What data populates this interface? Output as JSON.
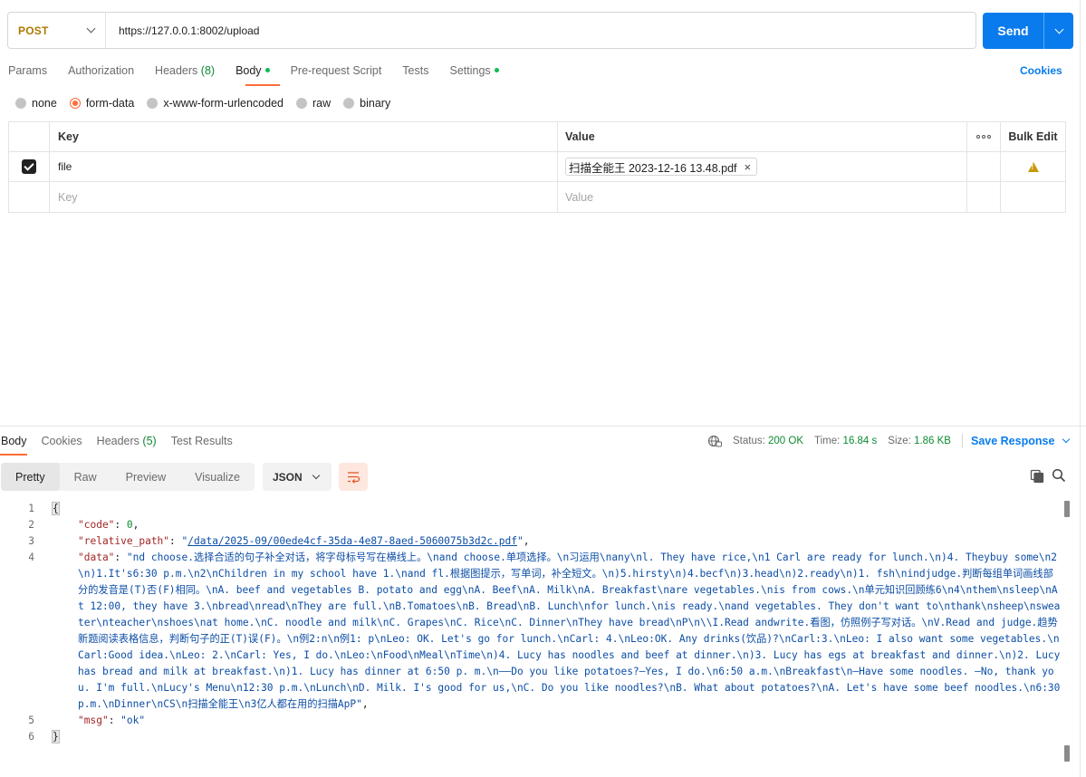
{
  "request": {
    "method": "POST",
    "url": "https://127.0.0.1:8002/upload",
    "send_label": "Send"
  },
  "tabs": {
    "params": "Params",
    "authorization": "Authorization",
    "headers": "Headers",
    "headers_count": "(8)",
    "body": "Body",
    "prerequest": "Pre-request Script",
    "tests": "Tests",
    "settings": "Settings",
    "cookies": "Cookies"
  },
  "body_types": [
    "none",
    "form-data",
    "x-www-form-urlencoded",
    "raw",
    "binary"
  ],
  "form_table": {
    "key_header": "Key",
    "value_header": "Value",
    "bulk_edit": "Bulk Edit",
    "rows": [
      {
        "key": "file",
        "value": "扫描全能王 2023-12-16 13.48.pdf",
        "checked": true
      }
    ],
    "key_placeholder": "Key",
    "value_placeholder": "Value"
  },
  "response": {
    "tabs": {
      "body": "Body",
      "cookies": "Cookies",
      "headers": "Headers",
      "headers_count": "(5)",
      "test_results": "Test Results"
    },
    "status_label": "Status:",
    "status_value": "200 OK",
    "time_label": "Time:",
    "time_value": "16.84 s",
    "size_label": "Size:",
    "size_value": "1.86 KB",
    "save_response": "Save Response",
    "views": [
      "Pretty",
      "Raw",
      "Preview",
      "Visualize"
    ],
    "format": "JSON",
    "json": {
      "open": "{",
      "close": "}",
      "code_key": "\"code\"",
      "code_val": "0",
      "path_key": "\"relative_path\"",
      "path_quote_open": "\"",
      "path_val": "/data/2025-09/00ede4cf-35da-4e87-8aed-5060075b3d2c.pdf",
      "path_quote_close": "\"",
      "data_key": "\"data\"",
      "data_val": "\"nd choose.选择合适的句子补全对话，将字母标号写在横线上。\\nand choose.单项选择。\\n习运用\\nany\\nl. They have rice,\\n1 Carl are ready for lunch.\\n)4. Theybuy some\\n2\\n)1.It's6:30 p.m.\\n2\\nChildren in my school have 1.\\nand fl.根据图提示，写单词，补全短文。\\n)5.hirsty\\n)4.becf\\n)3.head\\n)2.ready\\n)1. fsh\\nindjudge.判断每组单词画线部分的发音是(T)否(F)相同。\\nA. beef and vegetables B. potato and egg\\nA. Beef\\nA. Milk\\nA. Breakfast\\nare vegetables.\\nis from cows.\\n单元知识回顾练6\\n4\\nthem\\nsleep\\nAt 12:00, they have 3.\\nbread\\nread\\nThey are full.\\nB.Tomatoes\\nB. Bread\\nB. Lunch\\nfor lunch.\\nis ready.\\nand vegetables. They don't want to\\nthank\\nsheep\\nsweater\\nteacher\\nshoes\\nat home.\\nC. noodle and milk\\nC. Grapes\\nC. Rice\\nC. Dinner\\nThey have bread\\nP\\n\\\\I.Read andwrite.看图，仿照例子写对话。\\nV.Read and judge.趋势新题阅读表格信息，判断句子的正(T)误(F)。\\n例2:n\\n例1: p\\nLeo: OK. Let's go for lunch.\\nCarl: 4.\\nLeo:OK. Any drinks(饮品)?\\nCarl:3.\\nLeo: I also want some vegetables.\\nCarl:Good idea.\\nLeo: 2.\\nCarl: Yes, I do.\\nLeo:\\nFood\\nMeal\\nTime\\n)4. Lucy has noodles and beef at dinner.\\n)3. Lucy has egs at breakfast and dinner.\\n)2. Lucy has bread and milk at breakfast.\\n)1. Lucy has dinner at 6:50 p. m.\\n——Do you like potatoes?—Yes, I do.\\n6:50 a.m.\\nBreakfast\\n—Have some noodles. —No, thank you. I'm full.\\nLucy's Menu\\n12:30 p.m.\\nLunch\\nD. Milk. I's good for us,\\nC. Do you like noodles?\\nB. What about potatoes?\\nA. Let's have some beef noodles.\\n6:30 p.m.\\nDinner\\nCS\\n扫描全能王\\n3亿人都在用的扫描ApP\"",
      "msg_key": "\"msg\"",
      "msg_val": "\"ok\""
    }
  }
}
